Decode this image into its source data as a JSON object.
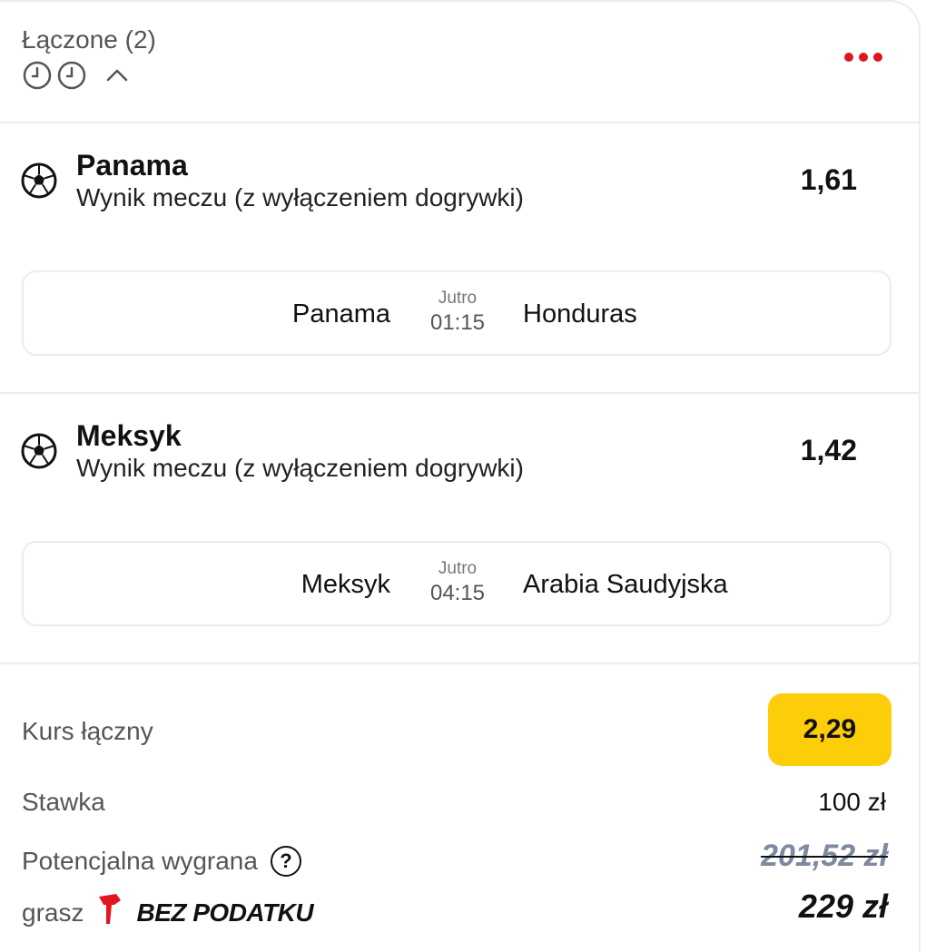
{
  "header": {
    "bet_type": "Łączone (2)"
  },
  "selections": [
    {
      "pick": "Panama",
      "market": "Wynik meczu (z wyłączeniem dogrywki)",
      "odds": "1,61",
      "home": "Panama",
      "day": "Jutro",
      "time": "01:15",
      "away": "Honduras"
    },
    {
      "pick": "Meksyk",
      "market": "Wynik meczu (z wyłączeniem dogrywki)",
      "odds": "1,42",
      "home": "Meksyk",
      "day": "Jutro",
      "time": "04:15",
      "away": "Arabia Saudyjska"
    }
  ],
  "summary": {
    "total_odds_label": "Kurs łączny",
    "total_odds": "2,29",
    "stake_label": "Stawka",
    "stake": "100 zł",
    "potential_win_label": "Potencjalna wygrana",
    "potential_win_old": "201,52 zł",
    "grasz_label": "grasz",
    "tax_free_label": "BEZ PODATKU",
    "potential_win": "229 zł"
  },
  "colors": {
    "accent_red": "#e0151f",
    "badge_yellow": "#fecd0a",
    "border": "#ececec"
  },
  "icons": [
    "clock-icon",
    "chevron-up-icon",
    "more-dots-icon",
    "football-icon",
    "help-icon",
    "hammer-logo-icon"
  ]
}
